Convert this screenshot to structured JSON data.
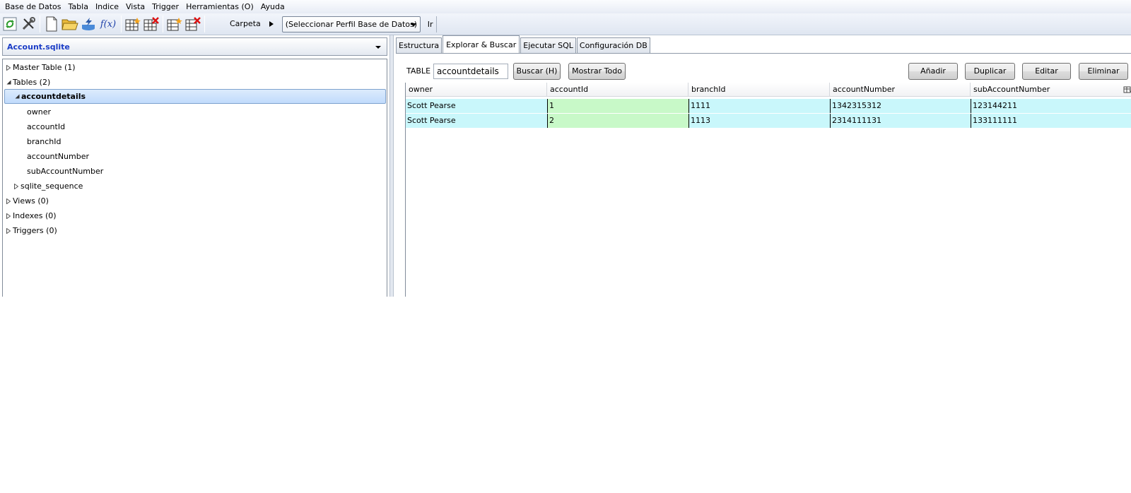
{
  "menu": [
    "Base de Datos",
    "Tabla",
    "Indice",
    "Vista",
    "Trigger",
    "Herramientas (O)",
    "Ayuda"
  ],
  "toolbar": {
    "folder_label": "Carpeta",
    "profile_select": "(Seleccionar Perfil Base de Datos)",
    "go_label": "Ir",
    "function_label": "f(x)"
  },
  "database": {
    "name": "Account.sqlite"
  },
  "tree": {
    "master": "Master Table (1)",
    "tables": "Tables (2)",
    "selected_table": "accountdetails",
    "columns": [
      "owner",
      "accountId",
      "branchId",
      "accountNumber",
      "subAccountNumber"
    ],
    "sequence": "sqlite_sequence",
    "views": "Views (0)",
    "indexes": "Indexes (0)",
    "triggers": "Triggers (0)"
  },
  "tabs": [
    "Estructura",
    "Explorar & Buscar",
    "Ejecutar SQL",
    "Configuración DB"
  ],
  "browse": {
    "table_label": "TABLE",
    "table_value": "accountdetails",
    "search_button": "Buscar (H)",
    "show_all_button": "Mostrar Todo",
    "add_button": "Añadir",
    "duplicate_button": "Duplicar",
    "edit_button": "Editar",
    "delete_button": "Eliminar"
  },
  "grid": {
    "headers": [
      "owner",
      "accountId",
      "branchId",
      "accountNumber",
      "subAccountNumber"
    ],
    "rows": [
      [
        "Scott Pearse",
        "1",
        "1111",
        "1342315312",
        "123144211"
      ],
      [
        "Scott Pearse",
        "2",
        "1113",
        "2314111131",
        "133111111"
      ]
    ]
  },
  "colors": {
    "row_bg": "#c9f7fb",
    "key_cell_bg": "#c8f9c8",
    "db_name": "#1a3cc6",
    "selection": "#c1dbfc"
  }
}
